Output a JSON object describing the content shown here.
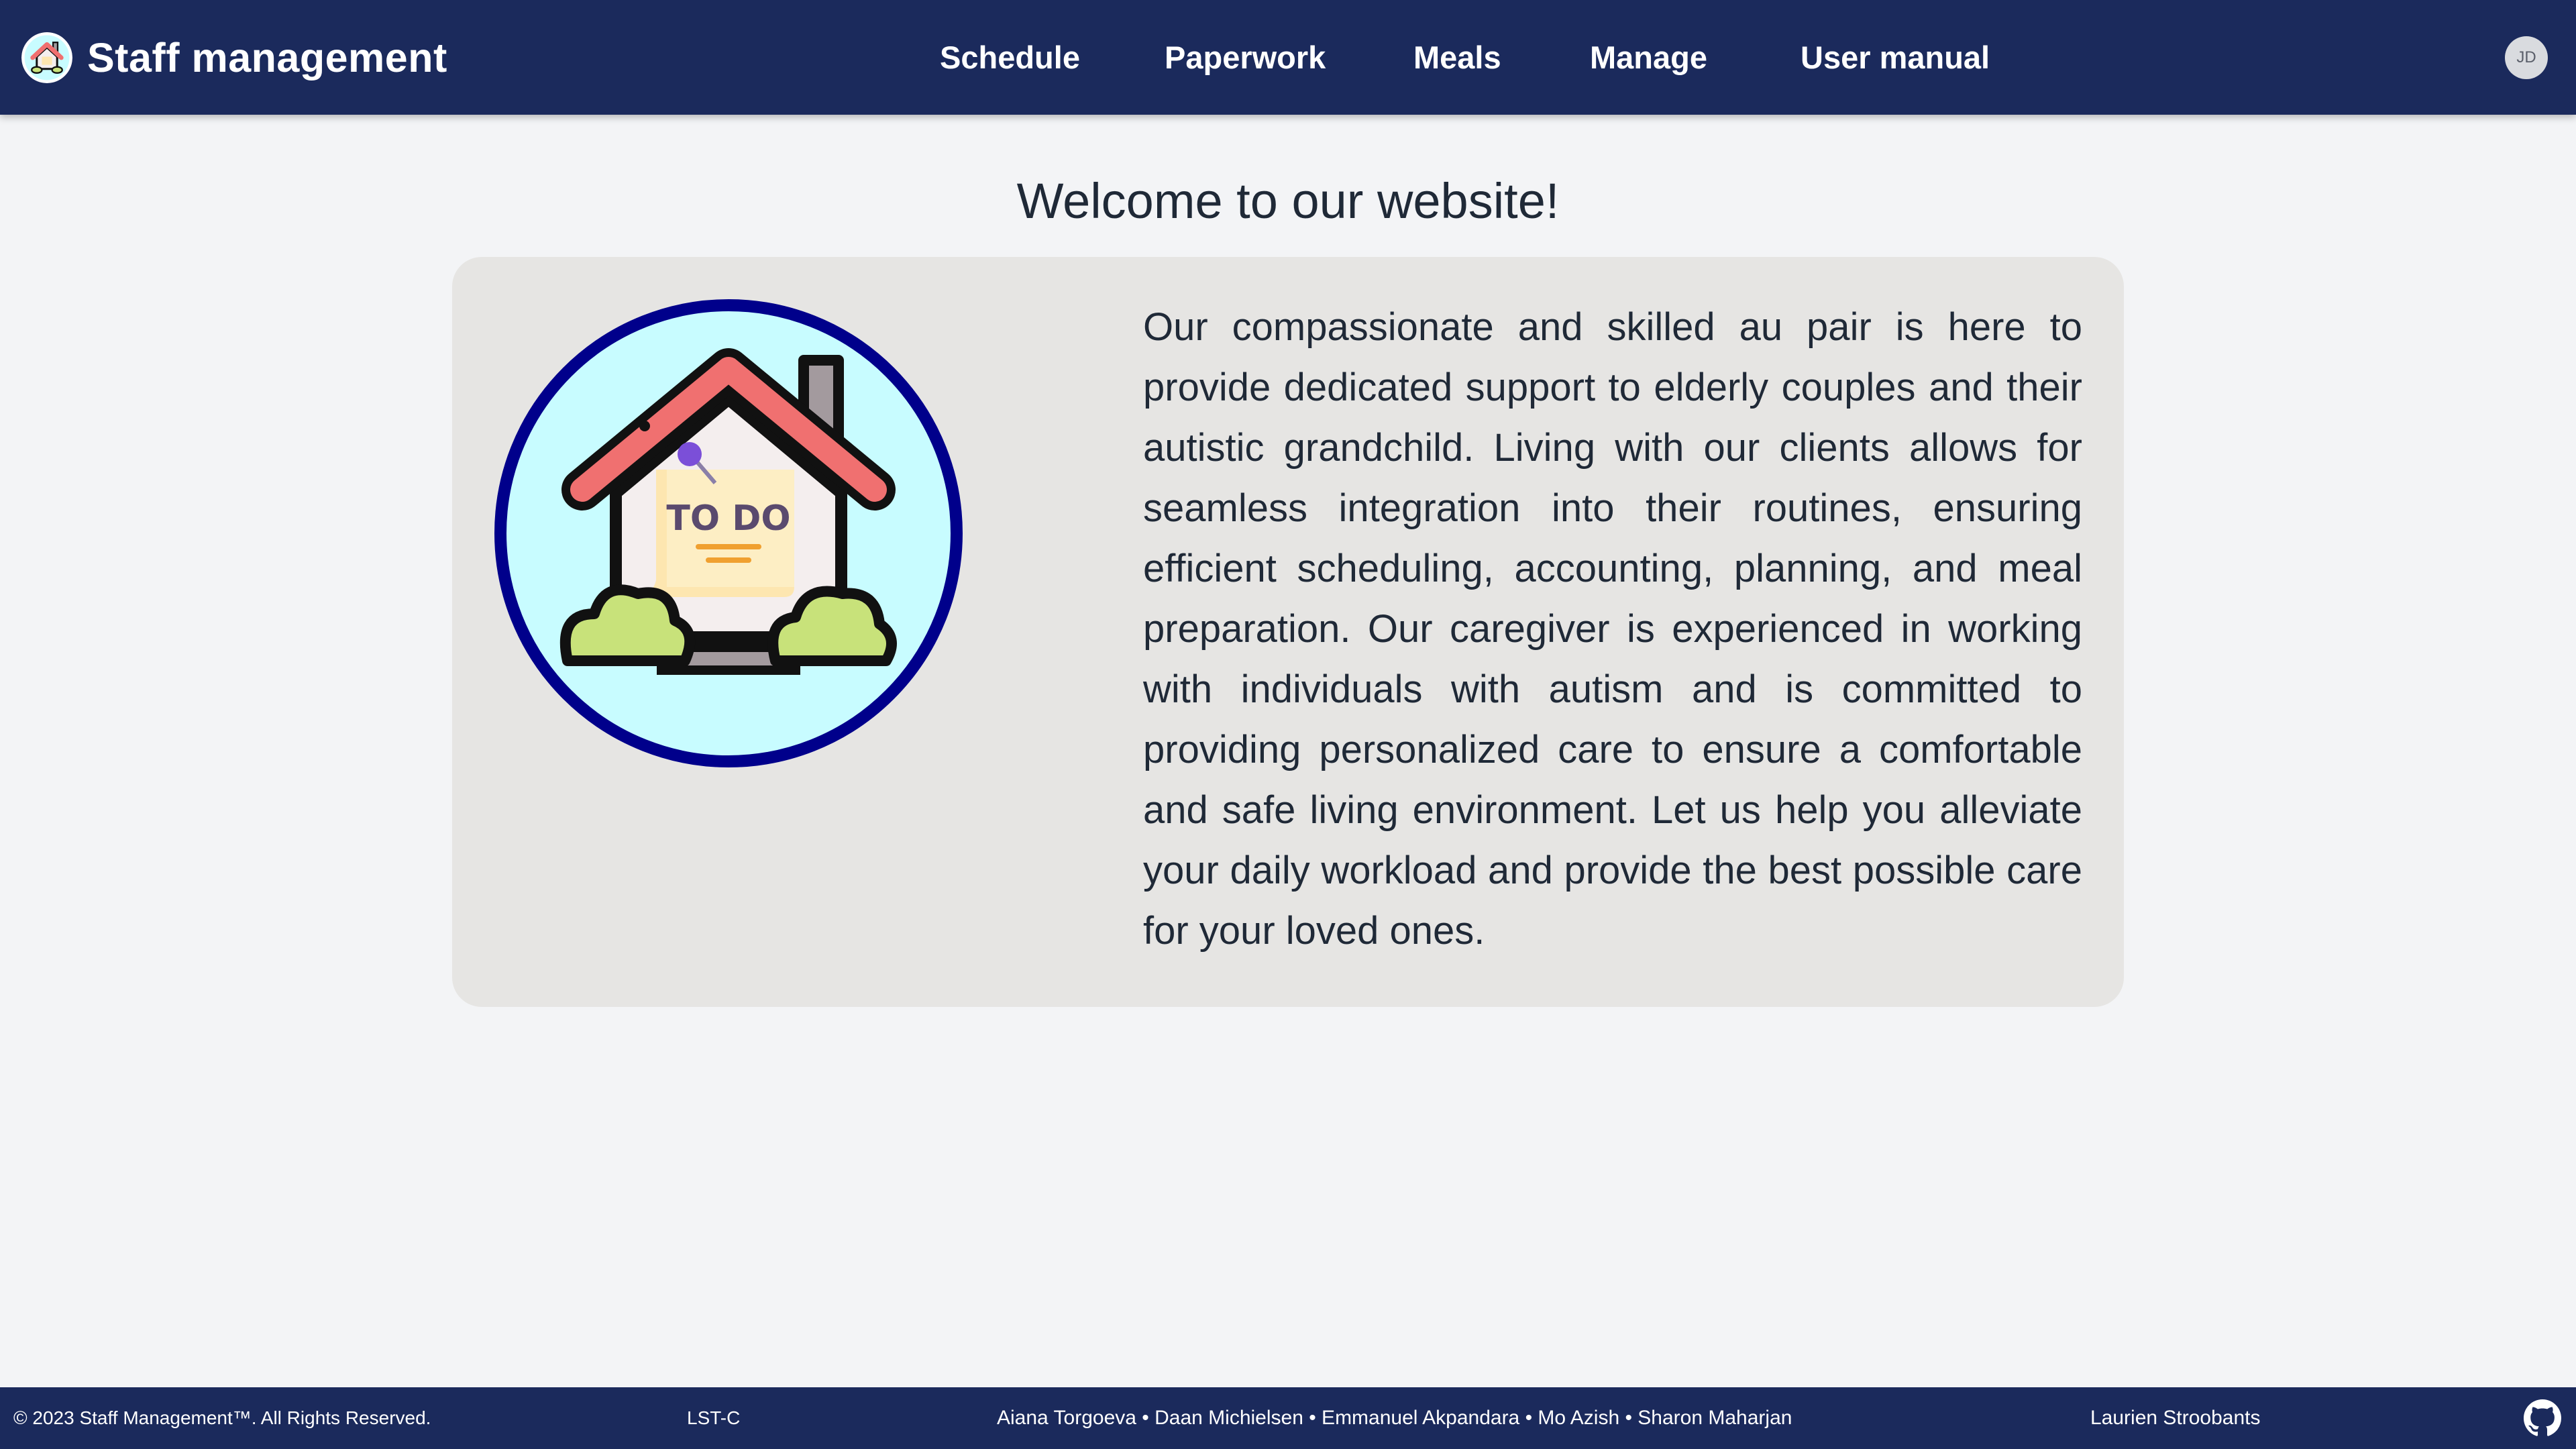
{
  "header": {
    "brand_title": "Staff management",
    "brand_logo_icon": "house-todo-icon",
    "nav": [
      {
        "label": "Schedule"
      },
      {
        "label": "Paperwork"
      },
      {
        "label": "Meals"
      },
      {
        "label": "Manage"
      },
      {
        "label": "User manual"
      }
    ],
    "avatar_initials": "JD",
    "background_color": "#1b2a5c"
  },
  "main": {
    "heading": "Welcome to our website!",
    "image_icon": "house-todo-illustration",
    "image_label": "TO DO",
    "description": "Our compassionate and skilled au pair is here to provide dedicated support to elderly couples and their autistic grandchild. Living with our clients allows for seamless integration into their routines, ensuring efficient scheduling, accounting, planning, and meal preparation. Our caregiver is experienced in working with individuals with autism and is committed to providing personalized care to ensure a comfortable and safe living environment. Let us help you alleviate your daily workload and provide the best possible care for your loved ones."
  },
  "footer": {
    "copyright": "© 2023 Staff Management™. All Rights Reserved.",
    "code": "LST-C",
    "team": "Aiana Torgoeva • Daan Michielsen • Emmanuel Akpandara • Mo Azish • Sharon Maharjan",
    "extra": "Laurien Stroobants",
    "github_icon": "github-icon"
  },
  "colors": {
    "accent": "#1b2a5c",
    "page_bg": "#f3f4f6",
    "card_bg": "#e6e5e3",
    "circle_border": "#00008b",
    "circle_fill": "#c8fcff"
  }
}
